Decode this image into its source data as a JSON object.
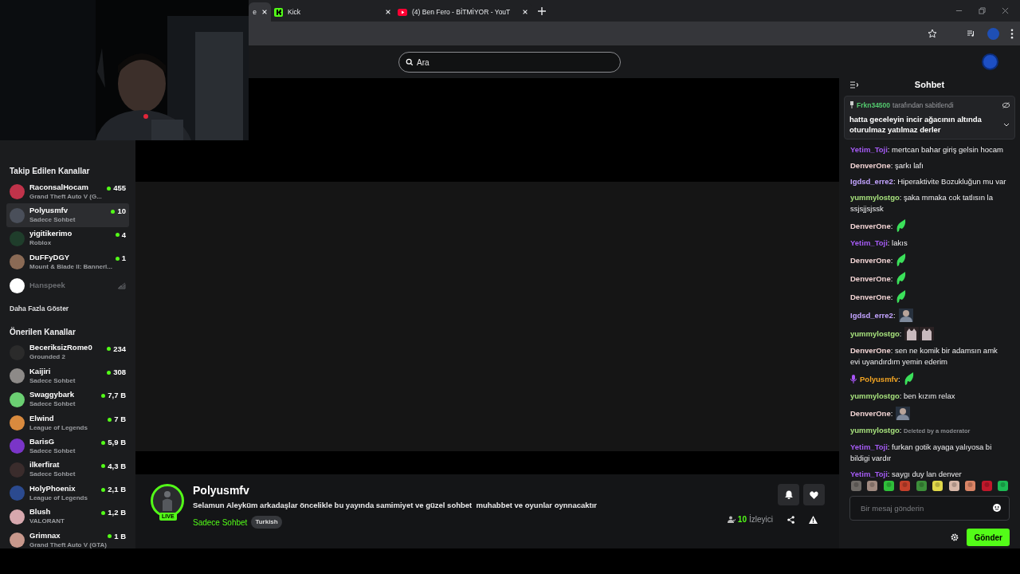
{
  "browser": {
    "tabs": [
      {
        "title": "e",
        "selected": true
      },
      {
        "title": "Kick",
        "selected": false
      },
      {
        "title": "(4) Ben Fero - BİTMİYOR - YouT",
        "selected": false
      }
    ]
  },
  "header": {
    "search": {
      "placeholder": "Ara"
    }
  },
  "sidebar": {
    "sections": [
      {
        "title": "Takip Edilen Kanallar",
        "channels": [
          {
            "name": "RaconsalHocam",
            "category": "Grand Theft Auto V (G...",
            "viewers": "455",
            "live": true,
            "selected": false
          },
          {
            "name": "Polyusmfv",
            "category": "Sadece Sohbet",
            "viewers": "10",
            "live": true,
            "selected": true
          },
          {
            "name": "yigitikerimo",
            "category": "Roblox",
            "viewers": "4",
            "live": true,
            "selected": false
          },
          {
            "name": "DuFFyDGY",
            "category": "Mount & Blade II: Bannerl...",
            "viewers": "1",
            "live": true,
            "selected": false
          },
          {
            "name": "Hanspeek",
            "live": false,
            "selected": false
          }
        ],
        "more": "Daha Fazla Göster"
      },
      {
        "title": "Önerilen Kanallar",
        "channels": [
          {
            "name": "BeceriksizRome0",
            "category": "Grounded 2",
            "viewers": "234",
            "live": true,
            "selected": false
          },
          {
            "name": "Kaijiri",
            "category": "Sadece Sohbet",
            "viewers": "308",
            "live": true,
            "selected": false
          },
          {
            "name": "Swaggybark",
            "category": "Sadece Sohbet",
            "viewers": "7,7 B",
            "live": true,
            "selected": false
          },
          {
            "name": "Elwind",
            "category": "League of Legends",
            "viewers": "7 B",
            "live": true,
            "selected": false
          },
          {
            "name": "BarisG",
            "category": "Sadece Sohbet",
            "viewers": "5,9 B",
            "live": true,
            "selected": false
          },
          {
            "name": "ilkerfirat",
            "category": "Sadece Sohbet",
            "viewers": "4,3 B",
            "live": true,
            "selected": false
          },
          {
            "name": "HolyPhoenix",
            "category": "League of Legends",
            "viewers": "2,1 B",
            "live": true,
            "selected": false
          },
          {
            "name": "Blush",
            "category": "VALORANT",
            "viewers": "1,2 B",
            "live": true,
            "selected": false
          },
          {
            "name": "Grimnax",
            "category": "Grand Theft Auto V (GTA)",
            "viewers": "1 B",
            "live": true,
            "selected": false
          }
        ]
      }
    ]
  },
  "stream": {
    "name": "Polyusmfv",
    "live_badge": "LIVE",
    "title": "Selamun Aleyküm arkadaşlar öncelikle bu yayında samimiyet ve güzel sohbet  muhabbet ve oyunlar oynnacaktır",
    "category": "Sadece Sohbet",
    "tag": "Turkish",
    "viewer_count": "10",
    "viewer_label": "İzleyici"
  },
  "chat": {
    "title": "Sohbet",
    "pinned": {
      "user": "Frkn34500",
      "by": "tarafından sabitlendi",
      "text": "hatta geceleyin incir ağacının altında oturulmaz yatılmaz derler"
    },
    "separator": ":",
    "messages": [
      {
        "kind": "text",
        "user": "Yetim_Toji",
        "color": "#a55bf5",
        "text": "mertcan bahar giriş gelsin hocam"
      },
      {
        "kind": "text",
        "user": "DenverOne",
        "color": "#f2d4d4",
        "text": "şarkı lafı"
      },
      {
        "kind": "text",
        "user": "Igdsd_erre2",
        "color": "#c2a3ff",
        "text": "Hiperaktivite Bozukluğun mu var"
      },
      {
        "kind": "text",
        "user": "yummylostgo",
        "color": "#a6e07c",
        "text": "şaka mmaka cok tatlısın la ssjsjjsjssk"
      },
      {
        "kind": "emote",
        "user": "DenverOne",
        "color": "#f2d4d4",
        "emotes": [
          {
            "kind": "leaf"
          }
        ]
      },
      {
        "kind": "text",
        "user": "Yetim_Toji",
        "color": "#a55bf5",
        "text": "lakıs"
      },
      {
        "kind": "emote",
        "user": "DenverOne",
        "color": "#f2d4d4",
        "emotes": [
          {
            "kind": "leaf"
          }
        ]
      },
      {
        "kind": "emote",
        "user": "DenverOne",
        "color": "#f2d4d4",
        "emotes": [
          {
            "kind": "leaf"
          }
        ]
      },
      {
        "kind": "emote",
        "user": "DenverOne",
        "color": "#f2d4d4",
        "emotes": [
          {
            "kind": "leaf"
          }
        ]
      },
      {
        "kind": "emote",
        "user": "Igdsd_erre2",
        "color": "#c2a3ff",
        "emotes": [
          {
            "kind": "person"
          }
        ]
      },
      {
        "kind": "emote",
        "user": "yummylostgo",
        "color": "#a6e07c",
        "emotes": [
          {
            "kind": "cat"
          },
          {
            "kind": "cat"
          }
        ]
      },
      {
        "kind": "text",
        "user": "DenverOne",
        "color": "#f2d4d4",
        "text": "sen ne komik bir adamsın amk evi uyandırdım yemin ederim"
      },
      {
        "kind": "broadcaster_emote",
        "user": "Polyusmfv",
        "color": "#f5a623",
        "emotes": [
          {
            "kind": "leaf"
          }
        ]
      },
      {
        "kind": "text",
        "user": "yummylostgo",
        "color": "#a6e07c",
        "text": "ben kızım relax"
      },
      {
        "kind": "emote",
        "user": "DenverOne",
        "color": "#f2d4d4",
        "emotes": [
          {
            "kind": "person"
          }
        ]
      },
      {
        "kind": "deleted",
        "user": "yummylostgo",
        "color": "#a6e07c",
        "text": "Deleted by a moderator"
      },
      {
        "kind": "text",
        "user": "Yetim_Toji",
        "color": "#a55bf5",
        "text": "furkan gotik ayaga yalıyosa bi bildigi vardır"
      },
      {
        "kind": "text",
        "user": "Yetim_Toji",
        "color": "#a55bf5",
        "text": "saygı duy lan denver"
      }
    ],
    "input": {
      "placeholder": "Bir mesaj gönderin"
    },
    "send": "Gönder"
  }
}
